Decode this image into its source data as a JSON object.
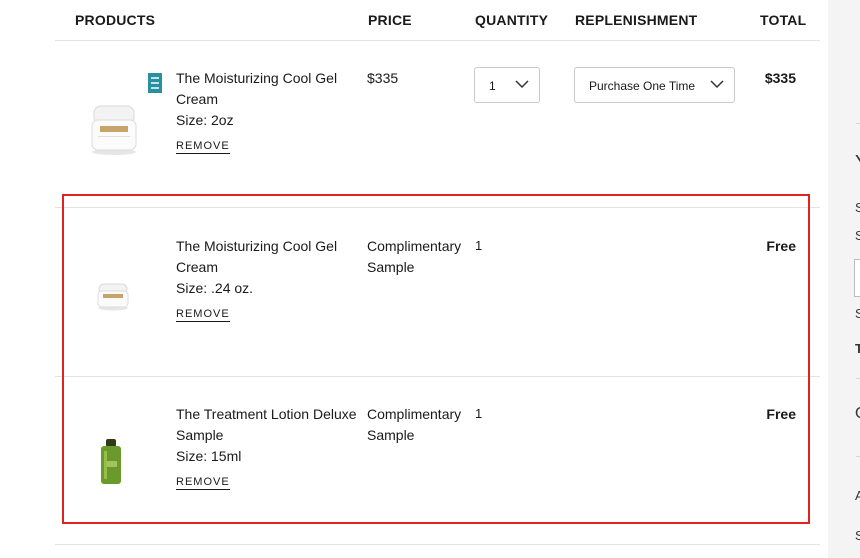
{
  "headers": {
    "products": "PRODUCTS",
    "price": "PRICE",
    "quantity": "QUANTITY",
    "replenishment": "REPLENISHMENT",
    "total": "TOTAL"
  },
  "items": [
    {
      "name": "The Moisturizing Cool Gel Cream",
      "size": "Size: 2oz",
      "remove": "REMOVE",
      "price": "$335",
      "quantity": "1",
      "replenishment": "Purchase One Time",
      "total": "$335"
    },
    {
      "name": "The Moisturizing Cool Gel Cream",
      "size": "Size: .24 oz.",
      "remove": "REMOVE",
      "price": "Complimentary Sample",
      "quantity": "1",
      "total": "Free"
    },
    {
      "name": "The Treatment Lotion Deluxe Sample",
      "size": "Size: 15ml",
      "remove": "REMOVE",
      "price": "Complimentary Sample",
      "quantity": "1",
      "total": "Free"
    }
  ],
  "sidebar_glyphs": [
    "Y",
    "S",
    "S",
    "S",
    "T",
    "O",
    "A",
    "S"
  ],
  "colors": {
    "highlight": "#e0231e",
    "badge": "#2a8f9e",
    "bottle": "#6a9a2a"
  }
}
